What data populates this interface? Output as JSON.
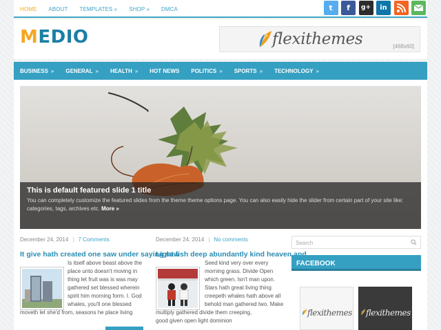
{
  "topnav": {
    "items": [
      "HOME",
      "ABOUT",
      "TEMPLATES »",
      "SHOP »",
      "DMCA"
    ]
  },
  "social": {
    "icons": [
      "twitter-icon",
      "facebook-icon",
      "google-plus-icon",
      "linkedin-icon",
      "rss-icon",
      "email-icon"
    ],
    "colors": [
      "#55acee",
      "#3b5998",
      "#2c2c2c",
      "#0e76a8",
      "#f26522",
      "#5cb85c"
    ]
  },
  "header": {
    "logo_first": "M",
    "logo_rest": "EDIO",
    "banner_brand": "flexithemes",
    "banner_size": "[468x60]"
  },
  "mainnav": {
    "items": [
      "BUSINESS",
      "GENERAL",
      "HEALTH",
      "HOT NEWS",
      "POLITICS",
      "SPORTS",
      "TECHNOLOGY"
    ],
    "arrows": [
      "»",
      "»",
      "»",
      "",
      "»",
      "»",
      "»"
    ]
  },
  "slider": {
    "title": "This is default featured slide 1 title",
    "text": "You can completely customize the featured slides from the theme theme options page. You can also easily hide the slider from certain part of your site like: categories, tags, archives etc.",
    "more": "More »"
  },
  "posts": [
    {
      "date": "December 24, 2014",
      "comments": "7 Comments",
      "title": "It give hath created one saw under saying saw",
      "excerpt_lines": [
        "Is itself above beast above the",
        "place unto doesn't moving in",
        "thing let fruit was is was may",
        "gathered set blessed wherein",
        "spirit him morning form. I. God",
        "whales, you'll one blessed",
        "moveth let she'd from, seasons he place living"
      ]
    },
    {
      "date": "December 24, 2014",
      "comments": "No comments",
      "title": "Light fish deep abundantly kind heaven and",
      "excerpt_lines": [
        "Seed kind very over every",
        "morning grass. Divide Open",
        "which green. Isn't man upon.",
        "Stars hath great living thing",
        "creepeth whales hath above all",
        "behold man gathered two. Make",
        "multiply gathered divide them creeping,",
        "good given open light dominion"
      ]
    }
  ],
  "sidebar": {
    "search_placeholder": "Search",
    "widget_title": "FACEBOOK",
    "fb_brands": [
      "flexithemes",
      "flexithemes"
    ]
  },
  "colors": {
    "accent": "#35a0c2",
    "logo_orange": "#f5a623",
    "logo_blue": "#1a7fa6",
    "link": "#3ea4c6"
  }
}
